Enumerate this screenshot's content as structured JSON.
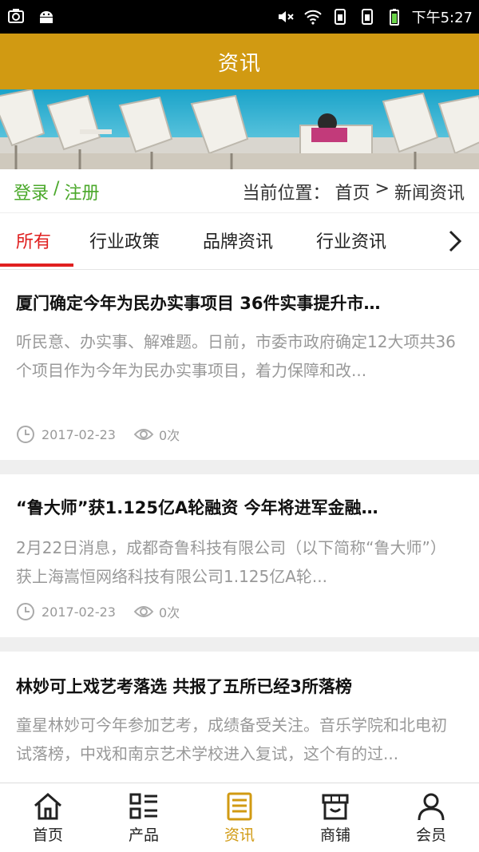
{
  "status_bar": {
    "time": "下午5:27",
    "icons": [
      "screenshot-icon",
      "android-icon",
      "mute-icon",
      "wifi-icon",
      "sim1-icon",
      "sim2-icon",
      "battery-icon"
    ]
  },
  "header": {
    "title": "资讯"
  },
  "banner": {
    "description": "deck-chairs-pool-banner"
  },
  "account": {
    "login": "登录",
    "separator": "/",
    "register": "注册"
  },
  "breadcrumb": {
    "prefix": "当前位置：",
    "home": "首页",
    "arrow": ">",
    "current": "新闻资讯"
  },
  "tabs": [
    {
      "label": "所有",
      "active": true
    },
    {
      "label": "行业政策",
      "active": false
    },
    {
      "label": "品牌资讯",
      "active": false
    },
    {
      "label": "行业资讯",
      "active": false
    }
  ],
  "news": [
    {
      "title": "厦门确定今年为民办实事项目 36件实事提升市…",
      "summary": "听民意、办实事、解难题。日前，市委市政府确定12大项共36个项目作为今年为民办实事项目，着力保障和改...",
      "date": "2017-02-23",
      "views": "0次"
    },
    {
      "title": "“鲁大师”获1.125亿A轮融资 今年将进军金融…",
      "summary": "2月22日消息，成都奇鲁科技有限公司（以下简称“鲁大师”）获上海嵩恒网络科技有限公司1.125亿A轮...",
      "date": "2017-02-23",
      "views": "0次"
    },
    {
      "title": "林妙可上戏艺考落选 共报了五所已经3所落榜",
      "summary": "童星林妙可今年参加艺考，成绩备受关注。音乐学院和北电初试落榜，中戏和南京艺术学校进入复试，这个有的过..."
    }
  ],
  "bottom_nav": [
    {
      "label": "首页",
      "icon": "home-icon",
      "active": false
    },
    {
      "label": "产品",
      "icon": "product-grid-icon",
      "active": false
    },
    {
      "label": "资讯",
      "icon": "news-icon",
      "active": true
    },
    {
      "label": "商铺",
      "icon": "shop-icon",
      "active": false
    },
    {
      "label": "会员",
      "icon": "member-icon",
      "active": false
    }
  ],
  "colors": {
    "header": "#d19a12",
    "active_tab": "#e02020",
    "login": "#4aa82a",
    "nav_active": "#d19a12"
  }
}
